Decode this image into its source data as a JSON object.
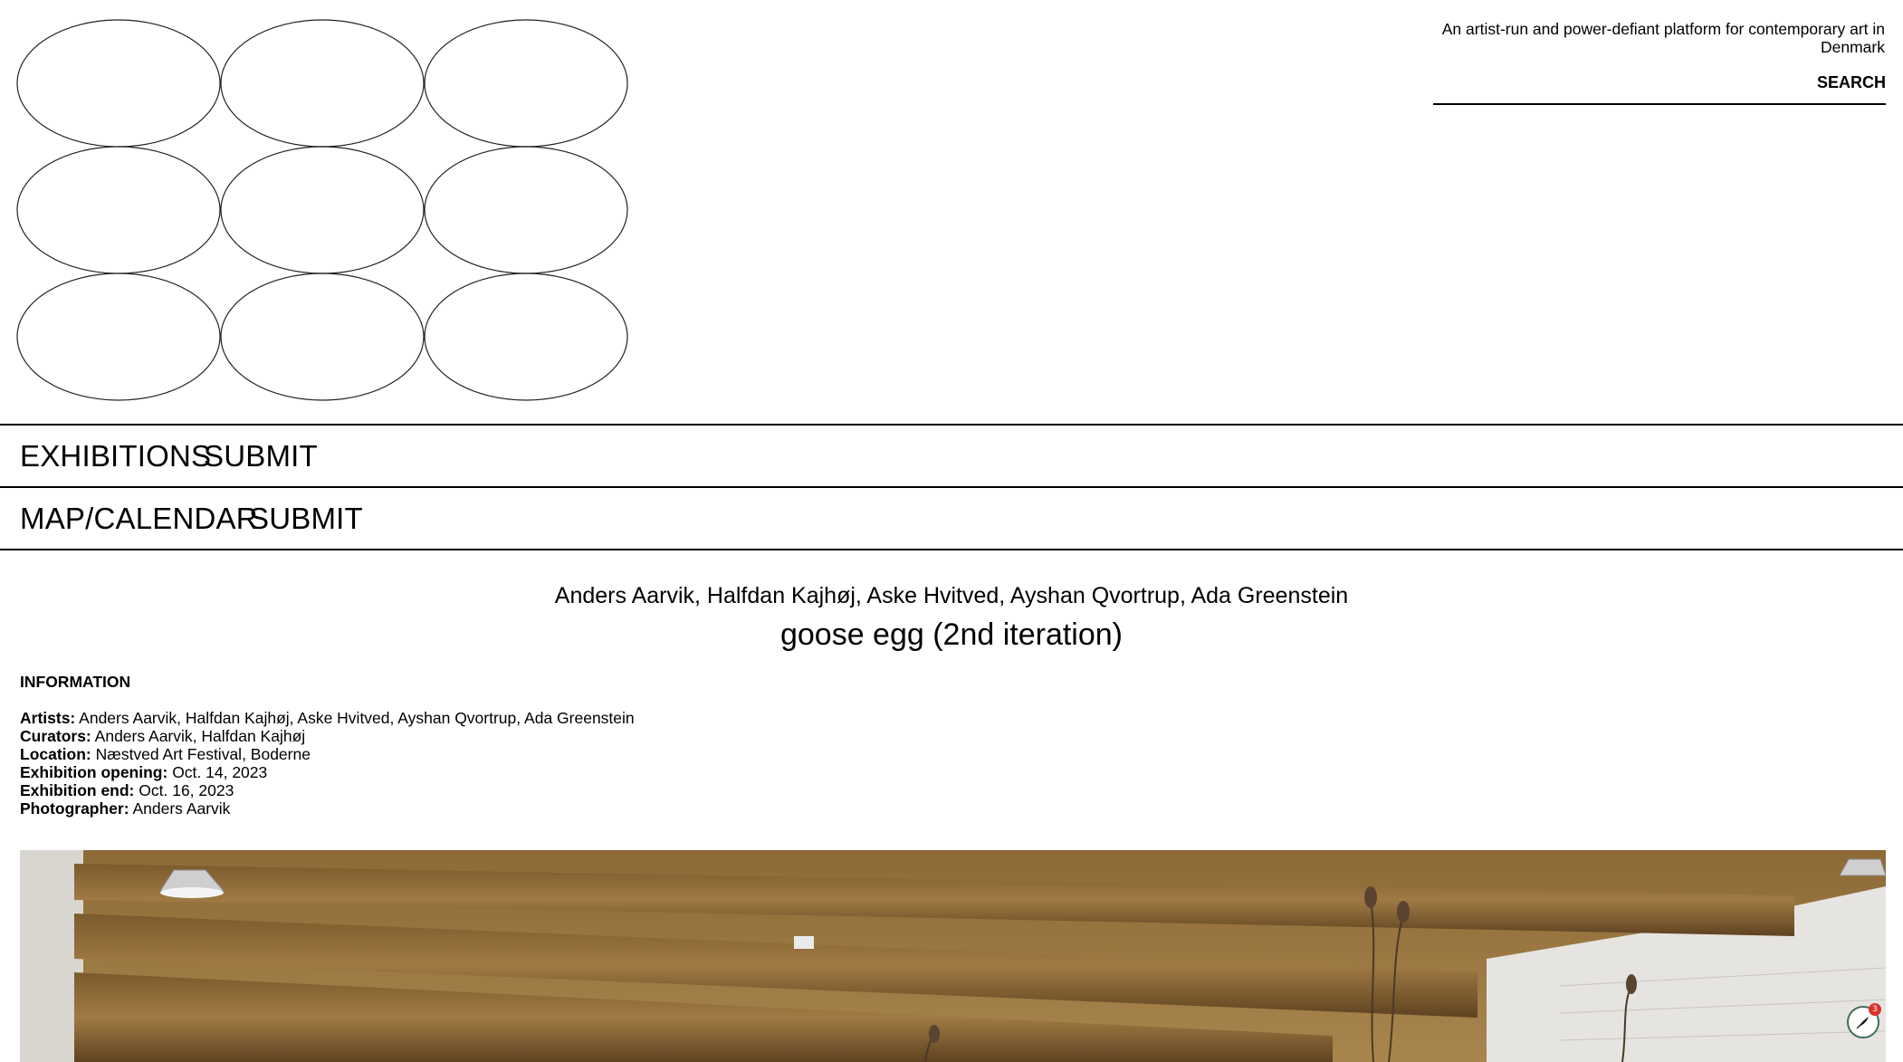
{
  "header": {
    "tagline": "An artist-run and power-defiant platform for contemporary art in Denmark",
    "search": {
      "placeholder": "",
      "button_label": "SEARCH"
    }
  },
  "nav_primary": {
    "items": [
      {
        "label": "EXHIBITIONS"
      },
      {
        "label": "SUBMIT"
      }
    ]
  },
  "nav_secondary": {
    "items": [
      {
        "label": "MAP/CALENDAR"
      },
      {
        "label": "SUBMIT"
      }
    ]
  },
  "exhibition": {
    "artists_line": "Anders Aarvik, Halfdan Kajhøj, Aske Hvitved, Ayshan Qvortrup, Ada Greenstein",
    "title": "goose egg (2nd iteration)",
    "info_heading": "INFORMATION",
    "info": [
      {
        "label": "Artists:",
        "value": "Anders Aarvik, Halfdan Kajhøj, Aske Hvitved, Ayshan Qvortrup, Ada Greenstein"
      },
      {
        "label": "Curators:",
        "value": "Anders Aarvik, Halfdan Kajhøj"
      },
      {
        "label": "Location:",
        "value": "Næstved Art Festival, Boderne"
      },
      {
        "label": "Exhibition opening:",
        "value": "Oct. 14, 2023"
      },
      {
        "label": "Exhibition end:",
        "value": "Oct. 16, 2023"
      },
      {
        "label": "Photographer:",
        "value": "Anders Aarvik"
      }
    ]
  },
  "chat_widget": {
    "icon": "quill-icon",
    "badge_count": "3",
    "accent_color": "#3f6f5d",
    "badge_color": "#d8342c"
  }
}
